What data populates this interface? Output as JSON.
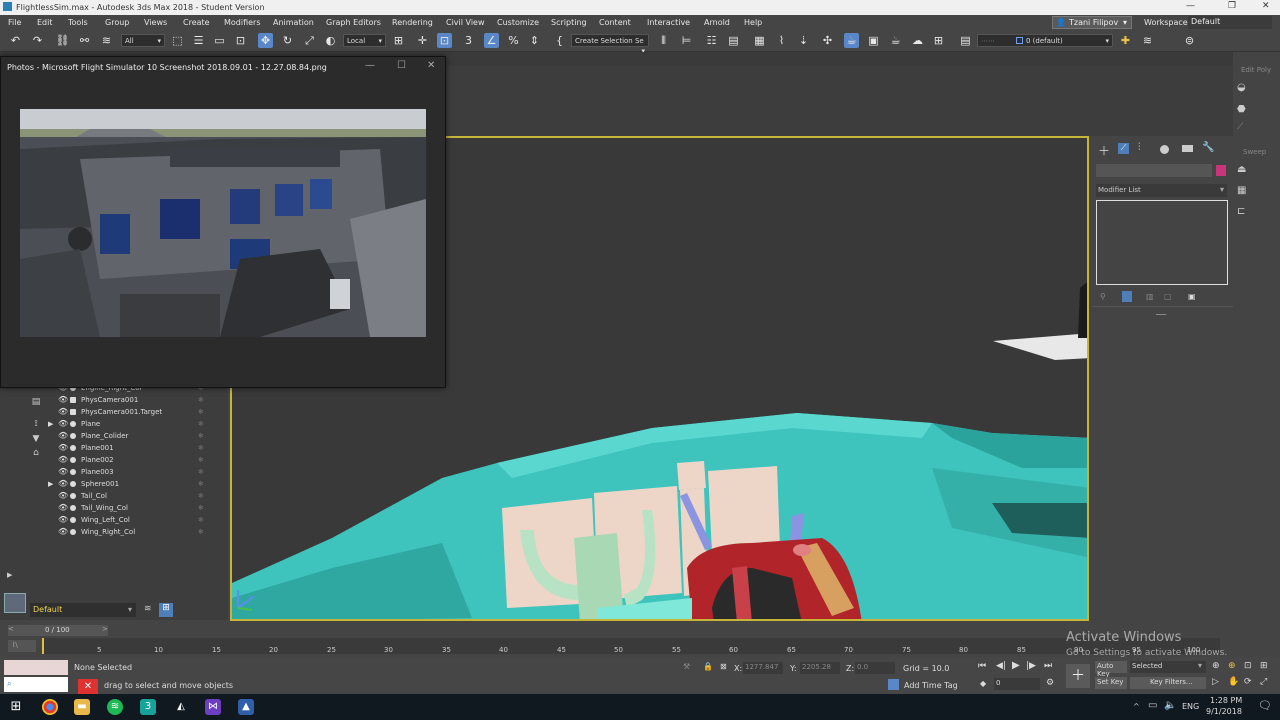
{
  "window": {
    "title": "FlightlessSim.max - Autodesk 3ds Max 2018 - Student Version"
  },
  "menu": [
    "File",
    "Edit",
    "Tools",
    "Group",
    "Views",
    "Create",
    "Modifiers",
    "Animation",
    "Graph Editors",
    "Rendering",
    "Civil View",
    "Customize",
    "Scripting",
    "Content",
    "Interactive",
    "Arnold",
    "Help"
  ],
  "user": {
    "name": "Tzani Filipov",
    "workspaces_label": "Workspaces:",
    "workspace": "Default"
  },
  "toolbar": {
    "filter": "All",
    "coord_system": "Local",
    "selection_set_placeholder": "Create Selection Se",
    "layer": "0 (default)"
  },
  "photos_window": {
    "title": "Photos - Microsoft Flight Simulator 10 Screenshot 2018.09.01 - 12.27.08.84.png"
  },
  "scene_explorer": {
    "rows": [
      {
        "name": "Engine_Right_Col",
        "expand": false
      },
      {
        "name": "PhysCamera001",
        "expand": false
      },
      {
        "name": "PhysCamera001.Target",
        "expand": false
      },
      {
        "name": "Plane",
        "expand": true
      },
      {
        "name": "Plane_Colider",
        "expand": false
      },
      {
        "name": "Plane001",
        "expand": false
      },
      {
        "name": "Plane002",
        "expand": false
      },
      {
        "name": "Plane003",
        "expand": false
      },
      {
        "name": "Sphere001",
        "expand": true
      },
      {
        "name": "Tail_Col",
        "expand": false
      },
      {
        "name": "Tail_Wing_Col",
        "expand": false
      },
      {
        "name": "Wing_Left_Col",
        "expand": false
      },
      {
        "name": "Wing_Right_Col",
        "expand": false
      }
    ],
    "layer_label": "Default"
  },
  "command_panel": {
    "modifier_list": "Modifier List",
    "edit_poly": "Edit Poly",
    "sweep": "Sweep"
  },
  "timeline": {
    "frame": "0 / 100",
    "ticks": [
      "5",
      "10",
      "15",
      "20",
      "25",
      "30",
      "35",
      "40",
      "45",
      "50",
      "55",
      "60",
      "65",
      "70",
      "75",
      "80",
      "85",
      "90",
      "95",
      "100"
    ]
  },
  "status": {
    "selection": "None Selected",
    "prompt": "drag to select and move objects",
    "x_label": "X:",
    "x": "1277.847",
    "y_label": "Y:",
    "y": "2205.28",
    "z_label": "Z:",
    "z": "0.0",
    "grid": "Grid = 10.0",
    "add_time_tag": "Add Time Tag",
    "auto_key": "Auto Key",
    "set_key": "Set Key",
    "selected": "Selected",
    "key_filters": "Key Filters...",
    "frame_value": "0"
  },
  "watermark": {
    "line1": "Activate Windows",
    "line2": "Go to Settings to activate Windows."
  },
  "taskbar": {
    "time": "1:28 PM",
    "date": "9/1/2018",
    "lang": "ENG"
  },
  "colors": {
    "viewport_border": "#c7b53a",
    "cockpit": "#40c9c0",
    "panel": "#edd6c8",
    "throttle": "#b0242a"
  }
}
